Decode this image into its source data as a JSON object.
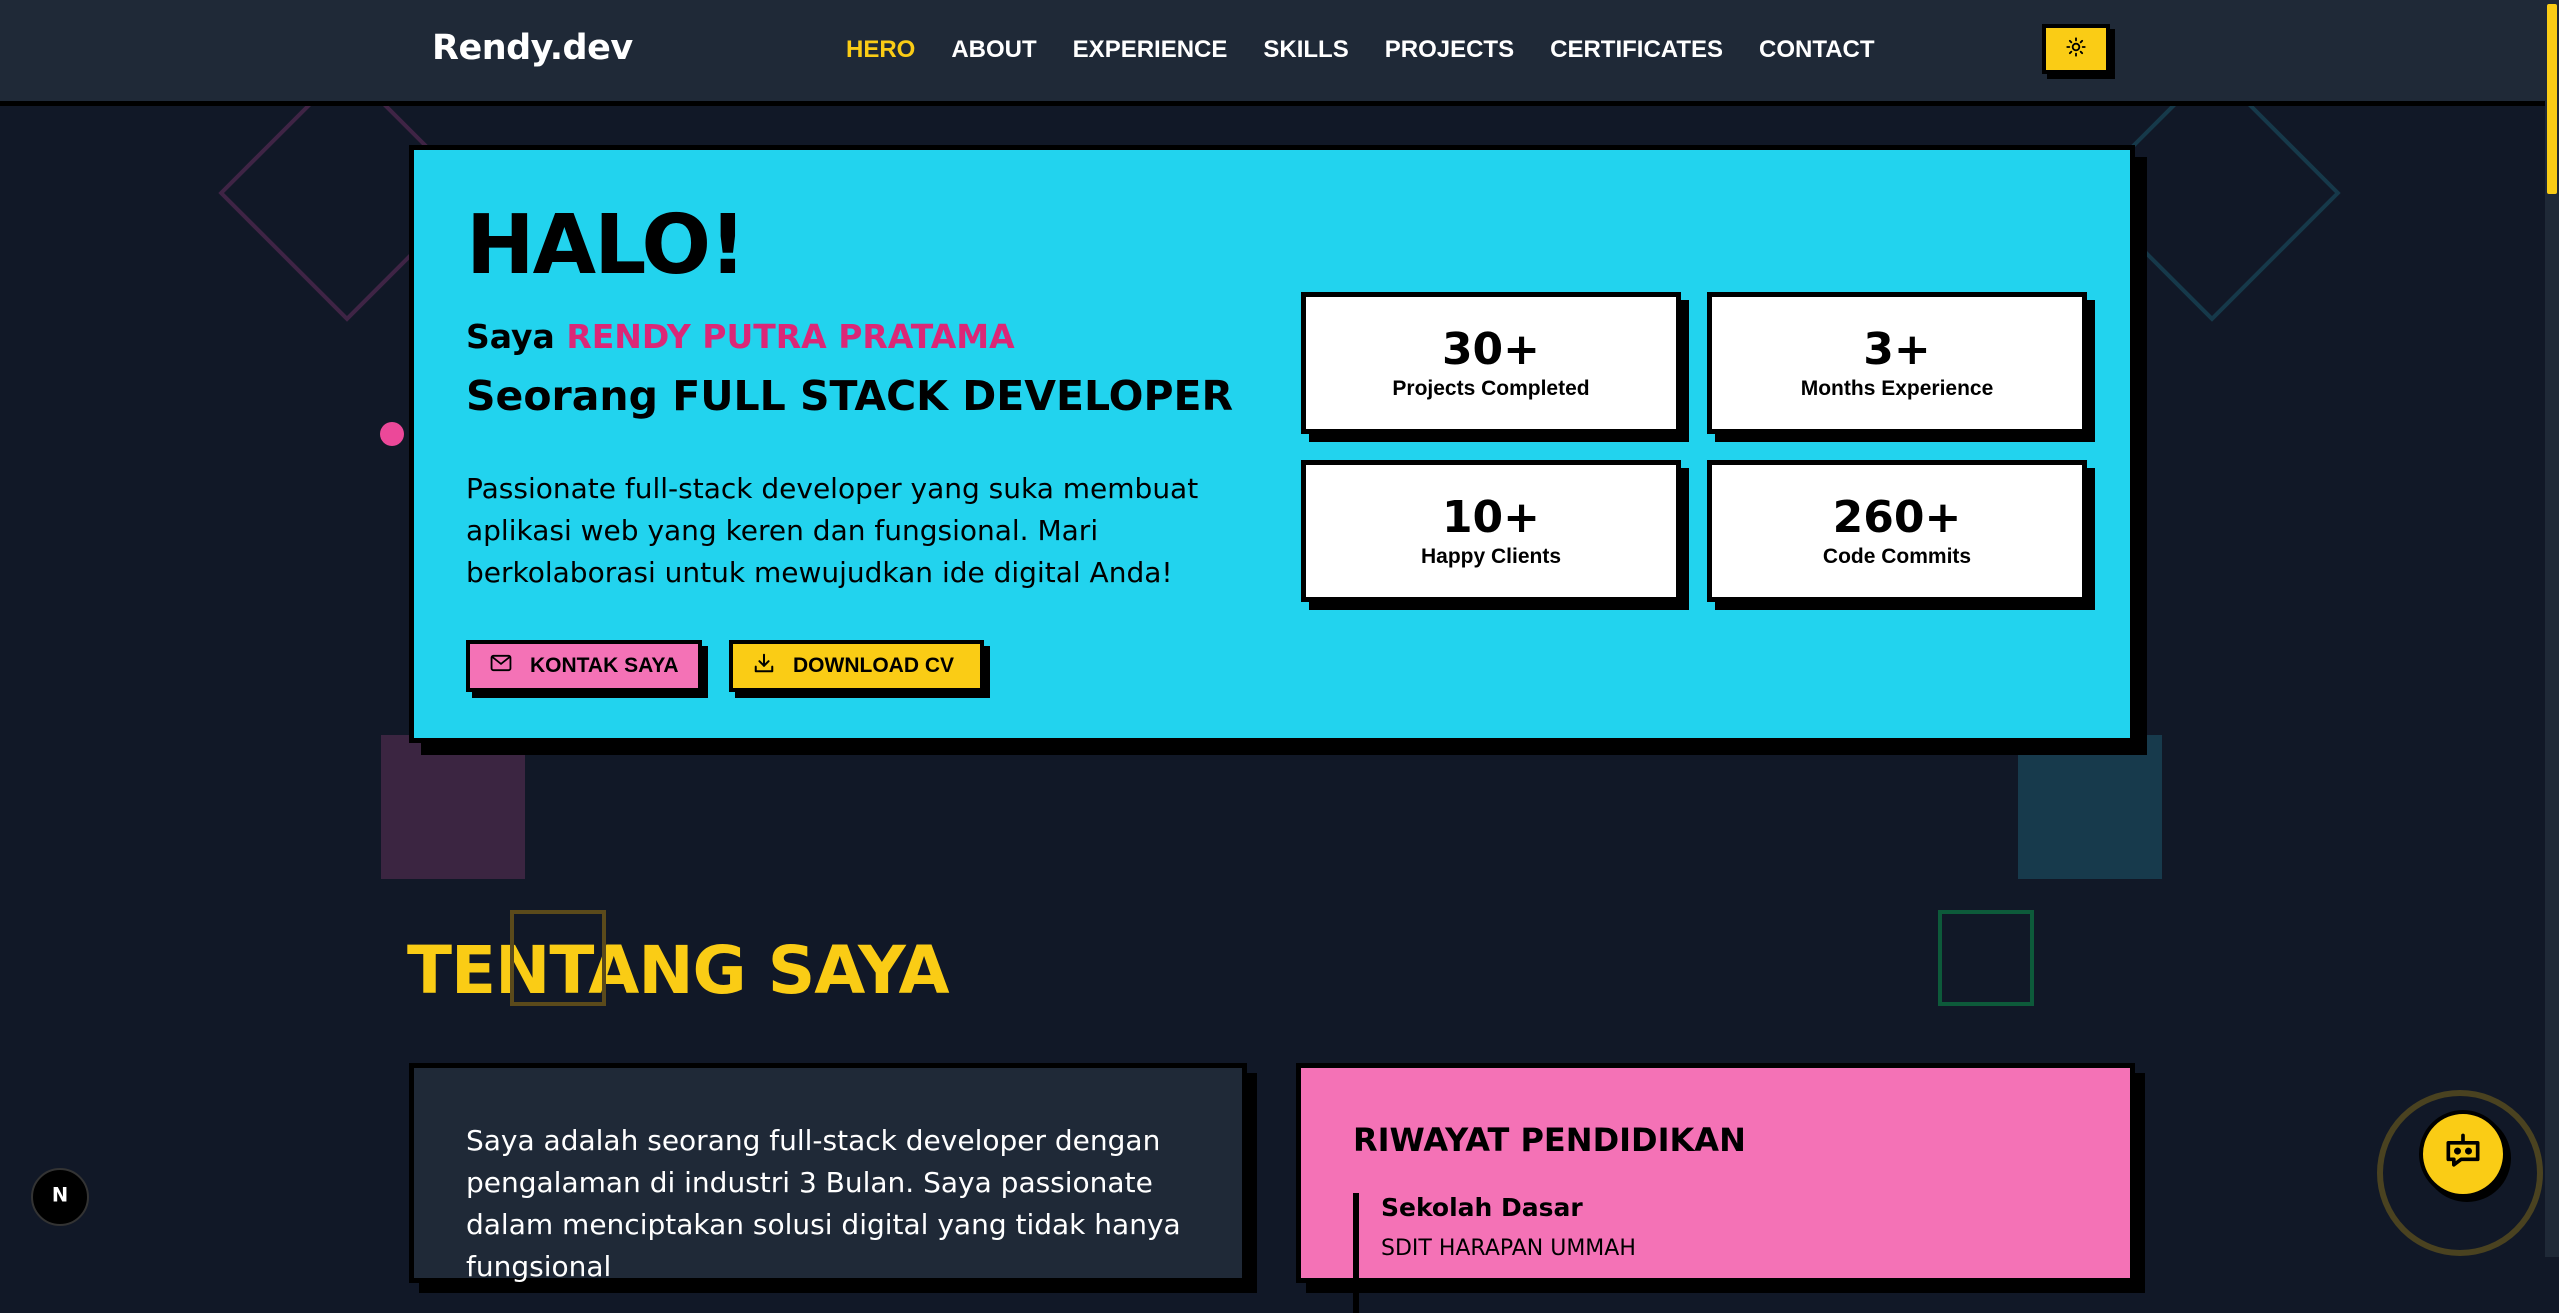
{
  "header": {
    "logo": "Rendy.dev",
    "nav": [
      {
        "label": "HERO",
        "active": true
      },
      {
        "label": "ABOUT",
        "active": false
      },
      {
        "label": "EXPERIENCE",
        "active": false
      },
      {
        "label": "SKILLS",
        "active": false
      },
      {
        "label": "PROJECTS",
        "active": false
      },
      {
        "label": "CERTIFICATES",
        "active": false
      },
      {
        "label": "CONTACT",
        "active": false
      }
    ],
    "theme_toggle_icon": "sun-icon"
  },
  "hero": {
    "title": "HALO!",
    "intro_prefix": "Saya",
    "name": "RENDY PUTRA PRATAMA",
    "role": "Seorang FULL STACK DEVELOPER",
    "description": "Passionate full-stack developer yang suka membuat aplikasi web yang keren dan fungsional. Mari berkolaborasi untuk mewujudkan ide digital Anda!",
    "buttons": {
      "contact": {
        "label": "KONTAK SAYA",
        "icon": "mail-icon"
      },
      "cv": {
        "label": "DOWNLOAD CV",
        "icon": "download-icon"
      }
    },
    "stats": [
      {
        "value": "30+",
        "label": "Projects Completed"
      },
      {
        "value": "3+",
        "label": "Months Experience"
      },
      {
        "value": "10+",
        "label": "Happy Clients"
      },
      {
        "value": "260+",
        "label": "Code Commits"
      }
    ]
  },
  "about": {
    "title": "TENTANG SAYA",
    "text": "Saya adalah seorang full-stack developer dengan pengalaman di industri 3 Bulan. Saya passionate dalam menciptakan solusi digital yang tidak hanya fungsional",
    "education": {
      "title": "RIWAYAT PENDIDIKAN",
      "items": [
        {
          "level": "Sekolah Dasar",
          "school": "SDIT HARAPAN UMMAH"
        }
      ]
    }
  },
  "floating": {
    "next_badge": "N",
    "chatbot_icon": "chatbot-icon"
  },
  "colors": {
    "background": "#111827",
    "navbar": "#1f2937",
    "accent_yellow": "#facc15",
    "hero_cyan": "#22d3ee",
    "pink": "#f472b6",
    "name_pink": "#db2777"
  }
}
